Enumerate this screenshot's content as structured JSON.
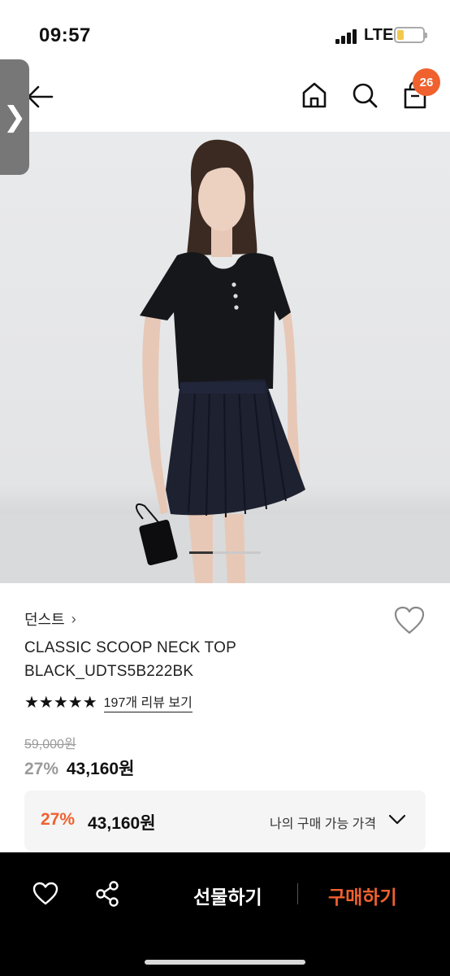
{
  "status_bar": {
    "time": "09:57",
    "network": "LTE",
    "battery_level": 0.25,
    "battery_color": "#f2c94c"
  },
  "nav": {
    "side_tab_glyph": "❯",
    "icons": [
      "arrow-left-icon",
      "home-icon",
      "search-icon",
      "shopping-bag-icon"
    ],
    "cart_count": "26",
    "badge_color": "#f0612e"
  },
  "gallery": {
    "active_index_fraction": 0.33
  },
  "product": {
    "brand": "던스트",
    "brand_chevron": "›",
    "title_line1": "CLASSIC SCOOP NECK TOP",
    "title_line2": "BLACK_UDTS5B222BK",
    "stars": "★★★★★",
    "rating": 5,
    "review_link": "197개 리뷰 보기",
    "original_price": "59,000원",
    "discount": "27%",
    "sale_price": "43,160원"
  },
  "my_price": {
    "discount": "27%",
    "price": "43,160원",
    "label": "나의 구매 가능 가격"
  },
  "bottom_bar": {
    "gift_label": "선물하기",
    "buy_label": "구매하기",
    "accent": "#f0612e"
  }
}
